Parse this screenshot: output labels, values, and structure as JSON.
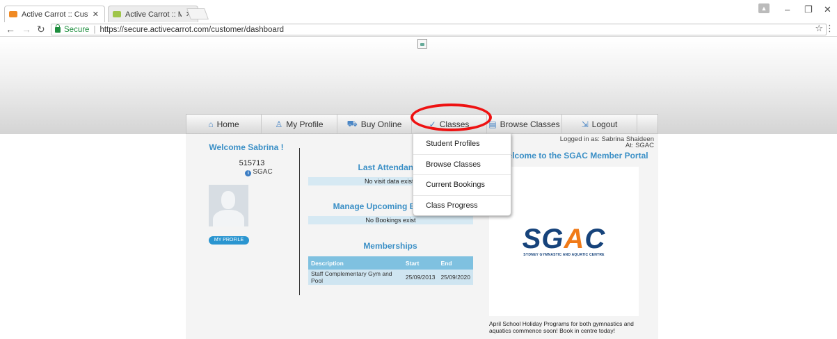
{
  "browser": {
    "tabs": [
      {
        "title": "Active Carrot :: Customer",
        "active": true
      },
      {
        "title": "Active Carrot :: Manager",
        "active": false
      }
    ],
    "secure_label": "Secure",
    "url": "https://secure.activecarrot.com/customer/dashboard"
  },
  "nav": {
    "items": [
      {
        "label": "Home",
        "icon": "home-icon"
      },
      {
        "label": "My Profile",
        "icon": "person-icon"
      },
      {
        "label": "Buy Online",
        "icon": "cart-icon"
      },
      {
        "label": "Classes",
        "icon": "check-icon"
      },
      {
        "label": "Browse Classes",
        "icon": "calendar-icon"
      },
      {
        "label": "Logout",
        "icon": "exit-icon"
      }
    ],
    "active": "Classes"
  },
  "dropdown": {
    "items": [
      "Student Profiles",
      "Browse Classes",
      "Current Bookings",
      "Class Progress"
    ]
  },
  "profile": {
    "welcome": "Welcome Sabrina !",
    "member_id": "515713",
    "centre": "SGAC",
    "button": "MY PROFILE"
  },
  "attendance": {
    "title": "Last Attendance",
    "empty": "No visit data exists"
  },
  "bookings": {
    "title": "Manage Upcoming Bookings",
    "empty": "No Bookings exist"
  },
  "memberships": {
    "title": "Memberships",
    "columns": [
      "Description",
      "Start",
      "End"
    ],
    "rows": [
      {
        "description": "Staff Complementary Gym and Pool",
        "start": "25/09/2013",
        "end": "25/09/2020"
      }
    ]
  },
  "account": {
    "logged_in": "Logged in as: Sabrina Shaideen",
    "at": "At: SGAC"
  },
  "portal": {
    "title": "Welcome to the SGAC Member Portal",
    "logo_text": "SGAC",
    "logo_sub": "SYDNEY GYMNASTIC AND AQUATIC CENTRE",
    "announcement": "April School Holiday Programs for both gymnastics and aquatics commence soon! Book in centre today!"
  },
  "colors": {
    "accent": "#3a8fc6",
    "highlight": "#e11111",
    "table_header": "#7fc1e0"
  }
}
